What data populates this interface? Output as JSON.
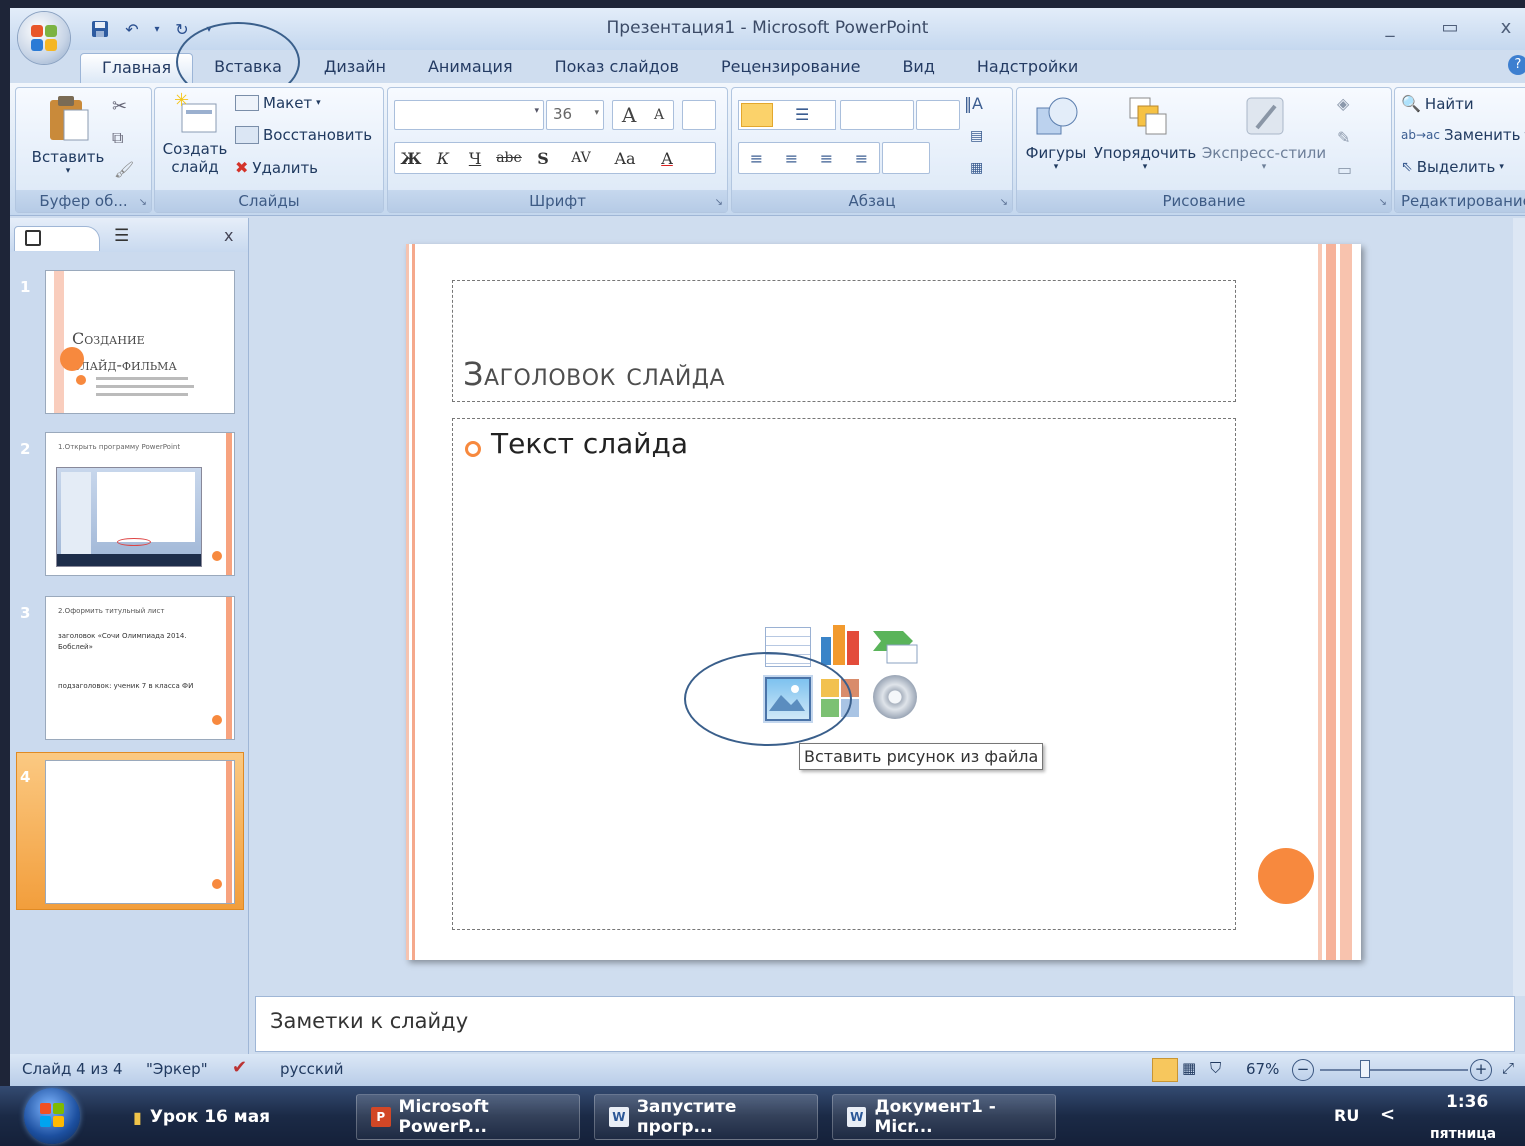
{
  "app": {
    "title": "Презентация1 - Microsoft PowerPoint"
  },
  "window_controls": {
    "minimize": "_",
    "restore": "▭",
    "close": "x"
  },
  "tabs": [
    {
      "label": "Главная"
    },
    {
      "label": "Вставка"
    },
    {
      "label": "Дизайн"
    },
    {
      "label": "Анимация"
    },
    {
      "label": "Показ слайдов"
    },
    {
      "label": "Рецензирование"
    },
    {
      "label": "Вид"
    },
    {
      "label": "Надстройки"
    }
  ],
  "ribbon": {
    "clipboard": {
      "paste": "Вставить",
      "group": "Буфер об..."
    },
    "slides": {
      "new_slide_line1": "Создать",
      "new_slide_line2": "слайд",
      "layout": "Макет",
      "reset": "Восстановить",
      "delete": "Удалить",
      "group": "Слайды"
    },
    "font": {
      "size": "36",
      "bold": "Ж",
      "italic": "К",
      "underline": "Ч",
      "strike": "abe",
      "shadow": "S",
      "spacing": "AV",
      "case": "Aa",
      "color": "A",
      "grow": "A",
      "shrink": "A",
      "group": "Шрифт"
    },
    "paragraph": {
      "group": "Абзац"
    },
    "drawing": {
      "shapes": "Фигуры",
      "arrange": "Упорядочить",
      "quick_styles": "Экспресс-стили",
      "group": "Рисование"
    },
    "editing": {
      "find": "Найти",
      "replace": "Заменить",
      "select": "Выделить",
      "group": "Редактирование"
    }
  },
  "thumbnails": [
    {
      "number": "1",
      "title_line1": "Создание",
      "title_line2": "слайд-фильма"
    },
    {
      "number": "2",
      "text": "1.Открыть программу PowerPoint"
    },
    {
      "number": "3",
      "text": "2.Оформить титульный лист",
      "bullet1": "заголовок «Сочи Олимпиада 2014. Бобслей»",
      "bullet2": "подзаголовок: ученик 7 в класса ФИ"
    },
    {
      "number": "4"
    }
  ],
  "slide": {
    "title": "Заголовок слайда",
    "bullet": "Текст слайда",
    "tooltip": "Вставить рисунок из файла"
  },
  "notes": {
    "placeholder": "Заметки к слайду"
  },
  "status": {
    "slide_info": "Слайд 4 из 4",
    "theme": "\"Эркер\"",
    "language": "русский",
    "zoom": "67%"
  },
  "taskbar": {
    "items": [
      {
        "label": "Урок 16 мая"
      },
      {
        "label": "Microsoft PowerP..."
      },
      {
        "label": "Запустите прогр..."
      },
      {
        "label": "Документ1 - Micr..."
      }
    ],
    "lang": "RU",
    "time": "1:36",
    "day": "пятница"
  },
  "colors": {
    "accent_orange": "#f7893e",
    "stripe_pink": "#f6b9a4",
    "ribbon_blue": "#c4d7ee"
  }
}
